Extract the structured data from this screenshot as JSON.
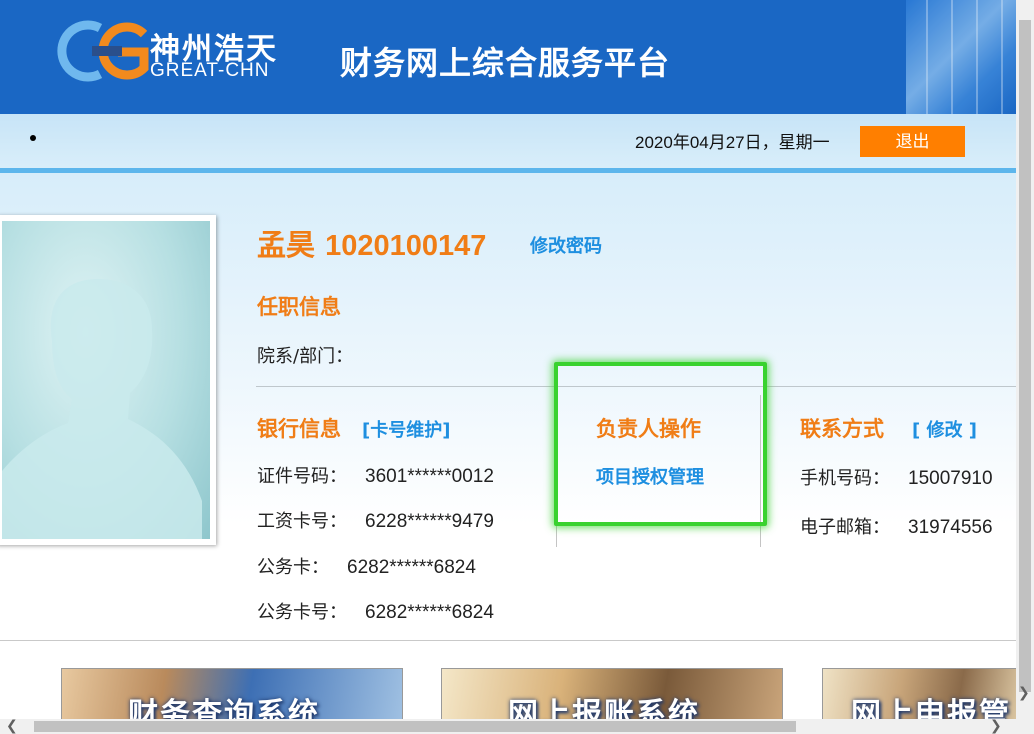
{
  "header": {
    "logo_cn": "神州浩天",
    "logo_en": "GREAT-CHN",
    "site_title": "财务网上综合服务平台"
  },
  "topbar": {
    "date_text": "2020年04月27日，星期一",
    "logout_label": "退出"
  },
  "profile": {
    "name": "孟昊",
    "user_id": "1020100147",
    "change_password_label": "修改密码",
    "employment_title": "任职信息",
    "department_label": "院系/部门：",
    "department_value": ""
  },
  "bank": {
    "title": "银行信息",
    "maintain_label": "[卡号维护]",
    "fields": [
      {
        "label": "证件号码：",
        "value": "3601******0012"
      },
      {
        "label": "工资卡号：",
        "value": "6228******9479"
      },
      {
        "label": "公务卡：",
        "value": "6282******6824"
      },
      {
        "label": "公务卡号：",
        "value": "6282******6824"
      }
    ]
  },
  "manager": {
    "title": "负责人操作",
    "project_auth_label": "项目授权管理"
  },
  "contact": {
    "title": "联系方式",
    "edit_label": "[ 修改 ]",
    "fields": [
      {
        "label": "手机号码：",
        "value": "15007910"
      },
      {
        "label": "电子邮箱：",
        "value": "31974556"
      }
    ]
  },
  "banners": [
    {
      "label": "财务查询系统"
    },
    {
      "label": "网上报账系统"
    },
    {
      "label": "网上申报管"
    }
  ],
  "colors": {
    "header_blue": "#1a67c4",
    "accent_orange": "#f07d16",
    "logout_orange": "#ff7f00",
    "link_blue": "#1e8fe0",
    "focus_green": "#39d22f"
  }
}
